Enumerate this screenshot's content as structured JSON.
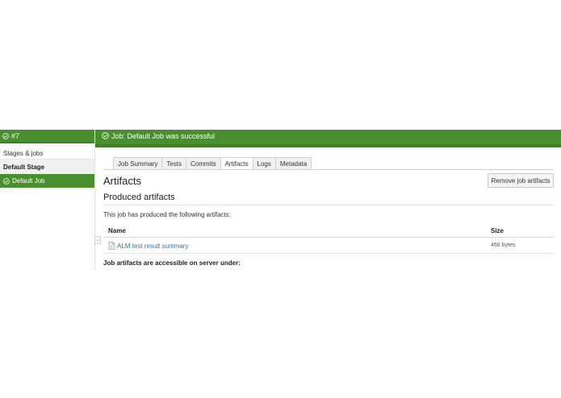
{
  "sidebar": {
    "build_number": "#7",
    "stages_label": "Stages & jobs",
    "stage_name": "Default Stage",
    "job_name": "Default Job"
  },
  "header": {
    "status_text": "Job: Default Job was successful"
  },
  "tabs": [
    {
      "label": "Job Summary",
      "active": false
    },
    {
      "label": "Tests",
      "active": false
    },
    {
      "label": "Commits",
      "active": false
    },
    {
      "label": "Artifacts",
      "active": true
    },
    {
      "label": "Logs",
      "active": false
    },
    {
      "label": "Metadata",
      "active": false
    }
  ],
  "artifacts": {
    "title": "Artifacts",
    "remove_button": "Remove job artifacts",
    "produced_title": "Produced artifacts",
    "description": "This job has produced the following artifacts:",
    "columns": {
      "name": "Name",
      "size": "Size"
    },
    "rows": [
      {
        "name": "ALM test result summary",
        "size": "466 bytes",
        "icon": "file-icon"
      }
    ],
    "server_note": "Job artifacts are accessible on server under:"
  },
  "colors": {
    "success_green": "#4a8f2f",
    "link_blue": "#3572b0"
  },
  "icons": {
    "status": "check-circle-icon",
    "collapse": "chevron-left-icon"
  }
}
